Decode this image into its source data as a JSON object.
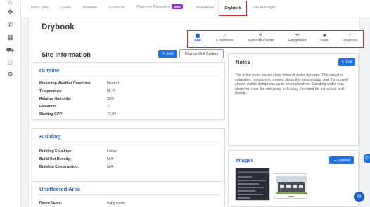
{
  "top_tabs": {
    "items": [
      "Basic Info",
      "Dates",
      "Timeline",
      "Financial",
      "Payment Requests",
      "Workbook",
      "Drybook",
      "File Manager"
    ],
    "new_badge": "New",
    "active": "Drybook"
  },
  "page": {
    "title": "Drybook"
  },
  "section_tabs": [
    "Site",
    "Chambers",
    "Moisture Points",
    "Equipment",
    "Visits",
    "Progress"
  ],
  "site_info": {
    "title": "Site Information",
    "edit_label": "Edit",
    "change_unit_label": "Change Unit System"
  },
  "outside": {
    "title": "Outside",
    "rows": [
      {
        "label": "Prevailing Weather Condition:",
        "value": "Neutral"
      },
      {
        "label": "Temperature:",
        "value": "95 °F"
      },
      {
        "label": "Relative Humidity:",
        "value": "30%"
      },
      {
        "label": "Elevation:",
        "value": "7'"
      },
      {
        "label": "Starting GPP:",
        "value": "73.84"
      }
    ]
  },
  "building": {
    "title": "Building",
    "rows": [
      {
        "label": "Building Envelope:",
        "value": "Loose"
      },
      {
        "label": "Build Out Density:",
        "value": "N/A"
      },
      {
        "label": "Building Construction:",
        "value": "N/A"
      }
    ]
  },
  "unaffected": {
    "title": "Unaffected Area",
    "rows": [
      {
        "label": "Room Name:",
        "value": "living room"
      }
    ]
  },
  "notes": {
    "title": "Notes",
    "edit_label": "Edit",
    "text": "The living room shows clear signs of water damage. The carpet is saturated, moisture is present along the baseboards, and the drywall shows visible dampness up to several inches. Standing water was observed near the entryway, indicating the need for extraction and drying."
  },
  "images": {
    "title": "Images",
    "upload_label": "Upload"
  },
  "colors": {
    "accent": "#1e73e8",
    "highlight": "#d32b2b",
    "title_blue": "#2b66c4",
    "badge": "#8e33d6"
  }
}
